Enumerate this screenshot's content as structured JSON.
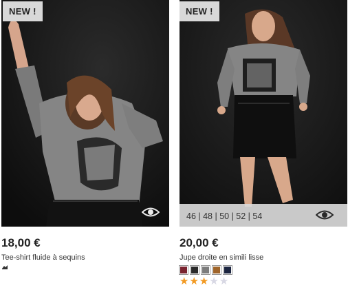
{
  "products": [
    {
      "badge": "NEW !",
      "price": "18,00 €",
      "name": "Tee-shirt fluide à sequins",
      "swatch_colors": [
        "#333333"
      ]
    },
    {
      "badge": "NEW !",
      "price": "20,00 €",
      "name": "Jupe droite en simili lisse",
      "sizes": "46 | 48 | 50 | 52 | 54",
      "swatch_colors": [
        "#7a2430",
        "#2b2b2b",
        "#7c7c7c",
        "#a0652a",
        "#1c2540"
      ],
      "rating": 3,
      "rating_max": 5,
      "star_filled_color": "#f29a22",
      "star_empty_color": "#d8d8e4"
    }
  ]
}
